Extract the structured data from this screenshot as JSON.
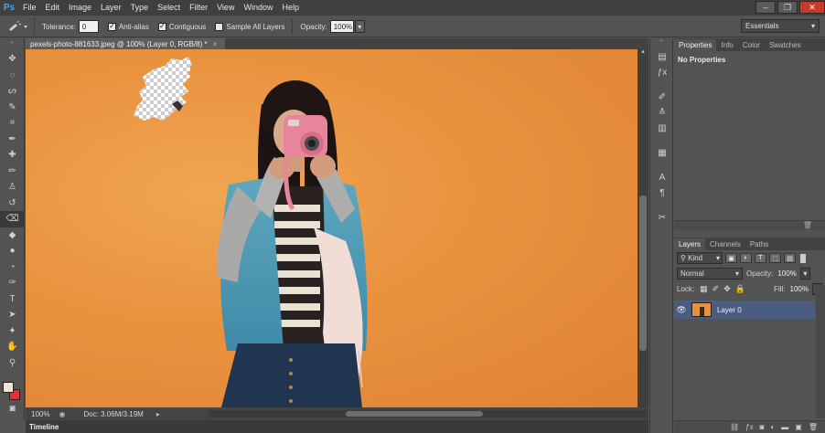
{
  "app": {
    "logo": "Ps"
  },
  "menu": [
    "File",
    "Edit",
    "Image",
    "Layer",
    "Type",
    "Select",
    "Filter",
    "View",
    "Window",
    "Help"
  ],
  "window_buttons": {
    "minimize": "–",
    "restore": "❐",
    "close": "✕"
  },
  "options": {
    "tolerance_label": "Tolerance:",
    "tolerance_value": "0",
    "antialias_label": "Anti-alias",
    "antialias_checked": true,
    "contiguous_label": "Contiguous",
    "contiguous_checked": true,
    "sample_all_label": "Sample All Layers",
    "sample_all_checked": false,
    "opacity_label": "Opacity:",
    "opacity_value": "100%",
    "workspace": "Essentials"
  },
  "document": {
    "tab_title": "pexels-photo-881633.jpeg @ 100% (Layer 0, RGB/8) *",
    "tab_close": "×",
    "zoom": "100%",
    "doc_info": "Doc: 3.06M/3.19M"
  },
  "timeline_label": "Timeline",
  "properties_panel": {
    "tabs": [
      "Properties",
      "Info",
      "Color",
      "Swatches"
    ],
    "message": "No Properties"
  },
  "layers_panel": {
    "tabs": [
      "Layers",
      "Channels",
      "Paths"
    ],
    "filter": "Kind",
    "blend_mode": "Normal",
    "opacity_label": "Opacity:",
    "opacity_value": "100%",
    "lock_label": "Lock:",
    "fill_label": "Fill:",
    "fill_value": "100%",
    "layer_name": "Layer 0"
  },
  "colors": {
    "foreground": "#efe6d2",
    "background": "#e0303a",
    "wall": "#e9923e",
    "selected_layer": "#4a5d80"
  }
}
